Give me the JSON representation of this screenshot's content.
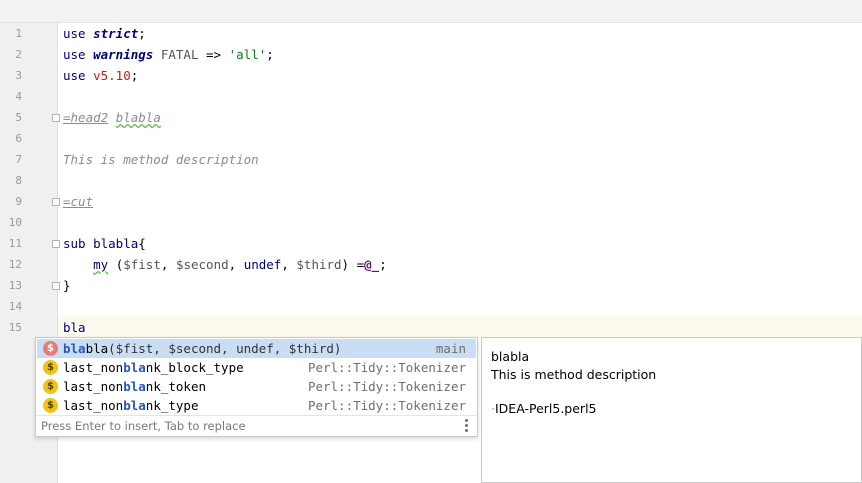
{
  "gutter": {
    "line_numbers": [
      "1",
      "2",
      "3",
      "4",
      "5",
      "6",
      "7",
      "8",
      "9",
      "10",
      "11",
      "12",
      "13",
      "14",
      "15"
    ]
  },
  "code": {
    "l1": {
      "use": "use",
      "pragma": "strict",
      "semi": ";"
    },
    "l2": {
      "use": "use",
      "pragma": "warnings",
      "fatal": " FATAL",
      "arrow": " => ",
      "str": "'all'",
      "semi": ";"
    },
    "l3": {
      "use": "use",
      "ver": "v5.10",
      "semi": ";"
    },
    "l5": {
      "pod_cmd": "=head2",
      "pod_arg": "blabla"
    },
    "l7": {
      "text": "This is method description"
    },
    "l9": {
      "pod_cmd": "=cut"
    },
    "l11": {
      "sub": "sub",
      "name": " blabla",
      "brace": "{"
    },
    "l12": {
      "indent": "    ",
      "my": "my",
      "open": " (",
      "v1": "$fist",
      "c1": ", ",
      "v2": "$second",
      "c2": ", ",
      "undef": "undef",
      "c3": ", ",
      "v3": "$third",
      "close": ") =",
      "args": "@_",
      "semi": ";"
    },
    "l13": {
      "brace": "}"
    },
    "l15": {
      "typed": "bla"
    }
  },
  "completion": {
    "items": [
      {
        "icon": "$",
        "match": "bla",
        "rest": "bla",
        "params": "($fist, $second, undef, $third)",
        "location": "main"
      },
      {
        "icon": "$",
        "prefix": "last_non",
        "match": "bla",
        "rest": "nk_block_type",
        "location": "Perl::Tidy::Tokenizer"
      },
      {
        "icon": "$",
        "prefix": "last_non",
        "match": "bla",
        "rest": "nk_token",
        "location": "Perl::Tidy::Tokenizer"
      },
      {
        "icon": "$",
        "prefix": "last_non",
        "match": "bla",
        "rest": "nk_type",
        "location": "Perl::Tidy::Tokenizer"
      }
    ],
    "ad_text": "Press Enter to insert, Tab to replace"
  },
  "doc": {
    "title": "blabla",
    "description": "This is method description",
    "bullet": "·",
    "source": "IDEA-Perl5.perl5"
  },
  "colors": {
    "selection": "#c9def5",
    "caret_line": "#fcfaed",
    "keyword": "#000080",
    "string": "#067d17"
  }
}
